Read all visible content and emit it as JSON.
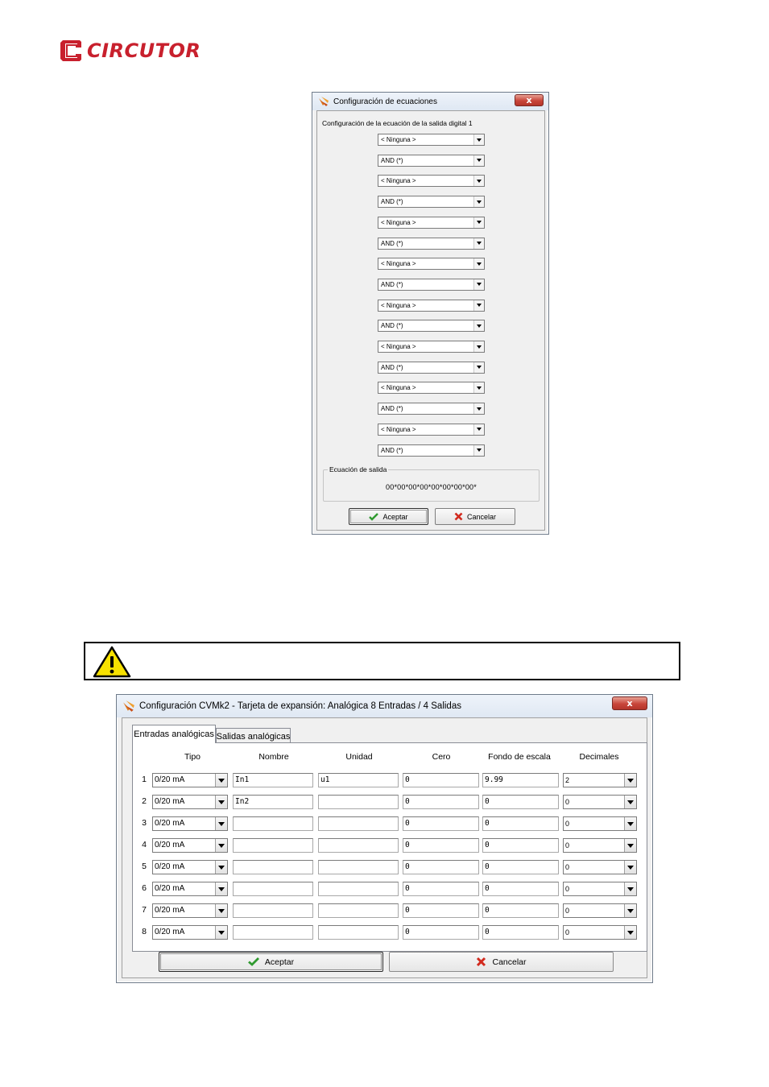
{
  "brand": {
    "name": "CIRCUTOR",
    "color": "#c8202d"
  },
  "equation_dialog": {
    "title": "Configuración de ecuaciones",
    "close_label": "x",
    "section_label": "Configuración de la ecuación de la salida digital 1",
    "combos": [
      "< Ninguna >",
      "AND (*)",
      "< Ninguna >",
      "AND (*)",
      "< Ninguna >",
      "AND (*)",
      "< Ninguna >",
      "AND (*)",
      "< Ninguna >",
      "AND (*)",
      "< Ninguna >",
      "AND (*)",
      "< Ninguna >",
      "AND (*)",
      "< Ninguna >",
      "AND (*)"
    ],
    "output_group_label": "Ecuación de salida",
    "output_equation": "00*00*00*00*00*00*00*00*",
    "accept_label": "Aceptar",
    "cancel_label": "Cancelar"
  },
  "warning": {
    "icon": "warning-triangle-icon"
  },
  "cvmk2_dialog": {
    "title": "Configuración CVMk2 - Tarjeta de expansión: Analógica 8 Entradas / 4 Salidas",
    "close_label": "x",
    "tabs": [
      {
        "label": "Entradas analógicas",
        "active": true
      },
      {
        "label": "Salidas analógicas",
        "active": false
      }
    ],
    "columns": {
      "tipo": "Tipo",
      "nombre": "Nombre",
      "unidad": "Unidad",
      "cero": "Cero",
      "fondo": "Fondo de escala",
      "decimales": "Decimales"
    },
    "rows": [
      {
        "num": "1",
        "tipo": "0/20 mA",
        "nombre": "In1",
        "unidad": "u1",
        "cero": "0",
        "fondo": "9.99",
        "decimales": "2"
      },
      {
        "num": "2",
        "tipo": "0/20 mA",
        "nombre": "In2",
        "unidad": "",
        "cero": "0",
        "fondo": "0",
        "decimales": "0"
      },
      {
        "num": "3",
        "tipo": "0/20 mA",
        "nombre": "",
        "unidad": "",
        "cero": "0",
        "fondo": "0",
        "decimales": "0"
      },
      {
        "num": "4",
        "tipo": "0/20 mA",
        "nombre": "",
        "unidad": "",
        "cero": "0",
        "fondo": "0",
        "decimales": "0"
      },
      {
        "num": "5",
        "tipo": "0/20 mA",
        "nombre": "",
        "unidad": "",
        "cero": "0",
        "fondo": "0",
        "decimales": "0"
      },
      {
        "num": "6",
        "tipo": "0/20 mA",
        "nombre": "",
        "unidad": "",
        "cero": "0",
        "fondo": "0",
        "decimales": "0"
      },
      {
        "num": "7",
        "tipo": "0/20 mA",
        "nombre": "",
        "unidad": "",
        "cero": "0",
        "fondo": "0",
        "decimales": "0"
      },
      {
        "num": "8",
        "tipo": "0/20 mA",
        "nombre": "",
        "unidad": "",
        "cero": "0",
        "fondo": "0",
        "decimales": "0"
      }
    ],
    "accept_label": "Aceptar",
    "cancel_label": "Cancelar"
  }
}
